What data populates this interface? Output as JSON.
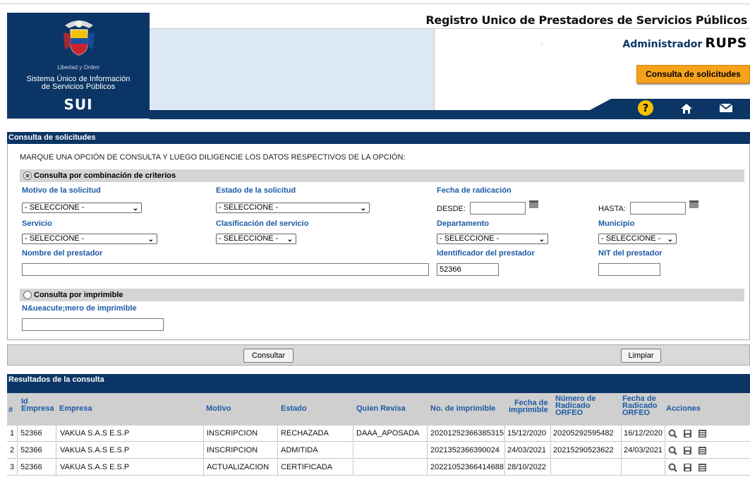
{
  "header": {
    "title": "Registro Unico de Prestadores de Servicios Públicos",
    "admin_label": "Administrador",
    "admin_brand": "RUPS",
    "consulta_button": "Consulta de solicitudes",
    "logo_motto": "Libertad y Orden",
    "logo_system_line1": "Sistema Único de Información",
    "logo_system_line2": "de Servicios Públicos",
    "logo_brand": "SUI",
    "nav_icons": [
      "help-icon",
      "home-icon",
      "mail-icon"
    ],
    "help_glyph": "?"
  },
  "form": {
    "section_title": "Consulta de solicitudes",
    "instruction": "MARQUE UNA OPCIÓN DE CONSULTA Y LUEGO DILIGENCIE LOS DATOS RESPECTIVOS DE LA OPCIÓN:",
    "group1_label": "Consulta por combinación de criterios",
    "motivo_label": "Motivo de la solicitud",
    "motivo_value": "- SELECCIONE -",
    "estado_label": "Estado de la solicitud",
    "estado_value": "- SELECCIONE -",
    "fecha_label": "Fecha de radicación",
    "desde_label": "DESDE:",
    "desde_value": "",
    "hasta_label": "HASTA:",
    "hasta_value": "",
    "servicio_label": "Servicio",
    "servicio_value": "- SELECCIONE -",
    "clasificacion_label": "Clasificación del servicio",
    "clasificacion_value": "- SELECCIONE -",
    "departamento_label": "Departamento",
    "departamento_value": "- SELECCIONE -",
    "municipio_label": "Municipio",
    "municipio_value": "- SELECCIONE -",
    "nombre_label": "Nombre del prestador",
    "nombre_value": "",
    "identificador_label": "Identificador del prestador",
    "identificador_value": "52366",
    "nit_label": "NIT del prestador",
    "nit_value": "",
    "group2_label": "Consulta por imprimible",
    "imprimible_label": "N&ueacute;mero de imprimible",
    "imprimible_value": "",
    "consultar_button": "Consultar",
    "limpiar_button": "Limpiar"
  },
  "results": {
    "section_title": "Resultados de la consulta",
    "columns": {
      "num": "#",
      "id1": "Id",
      "id2": "Empresa",
      "empresa": "Empresa",
      "motivo": "Motivo",
      "estado": "Estado",
      "quien": "Quien Revisa",
      "imprimible": "No. de imprimible",
      "fecha_imp1": "Fecha de",
      "fecha_imp2": "imprimible",
      "radicado1": "Número de",
      "radicado2": "Radicado",
      "radicado3": "ORFEO",
      "fecha_rad1": "Fecha de",
      "fecha_rad2": "Radicado",
      "fecha_rad3": "ORFEO",
      "acciones": "Acciones"
    },
    "rows": [
      {
        "num": "1",
        "id": "52366",
        "empresa": "VAKUA S.A.S E.S.P",
        "motivo": "INSCRIPCION",
        "estado": "RECHAZADA",
        "quien": "DAAA_APOSADA",
        "imprimible": "20201252366385315",
        "fecha_imp": "15/12/2020",
        "radicado": "20205292595482",
        "fecha_rad": "16/12/2020"
      },
      {
        "num": "2",
        "id": "52366",
        "empresa": "VAKUA S.A.S E.S.P",
        "motivo": "INSCRIPCION",
        "estado": "ADMITIDA",
        "quien": "",
        "imprimible": "2021352366390024",
        "fecha_imp": "24/03/2021",
        "radicado": "20215290523622",
        "fecha_rad": "24/03/2021"
      },
      {
        "num": "3",
        "id": "52366",
        "empresa": "VAKUA S.A.S E.S.P",
        "motivo": "ACTUALIZACION",
        "estado": "CERTIFICADA",
        "quien": "",
        "imprimible": "20221052366414688",
        "fecha_imp": "28/10/2022",
        "radicado": "",
        "fecha_rad": ""
      }
    ],
    "action_icons": [
      "search-icon",
      "save-icon",
      "detail-icon"
    ]
  },
  "colors": {
    "navy": "#0b3565",
    "orange": "#f7a21b",
    "label_blue": "#1d5aa6",
    "banner": "#dde8f6"
  }
}
